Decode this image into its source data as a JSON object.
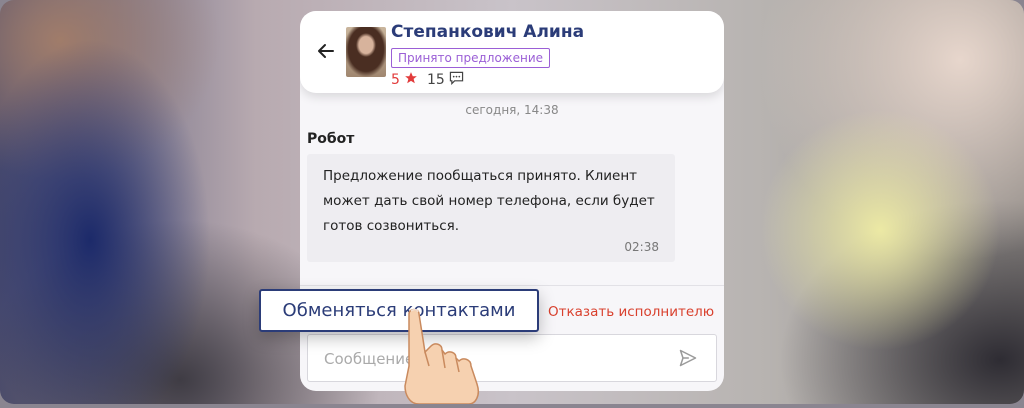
{
  "header": {
    "name": "Степанкович Алина",
    "status_badge": "Принято предложение",
    "rating": "5",
    "reviews_count": "15"
  },
  "chat": {
    "date_label": "сегодня, 14:38",
    "messages": [
      {
        "sender": "Робот",
        "text": "Предложение пообщаться принято. Клиент может дать свой номер телефона, если будет готов созвониться.",
        "time": "02:38"
      }
    ]
  },
  "actions": {
    "exchange_contacts": "Обменяться контактами",
    "decline_executor": "Отказать исполнителю"
  },
  "composer": {
    "placeholder": "Сообщение"
  },
  "colors": {
    "brand": "#2b3c78",
    "accent_purple": "#9b5fd6",
    "danger": "#d9412e",
    "star": "#e23b3b"
  },
  "icons": [
    "back-arrow-icon",
    "star-icon",
    "comment-icon",
    "send-icon",
    "pointing-hand-icon"
  ]
}
